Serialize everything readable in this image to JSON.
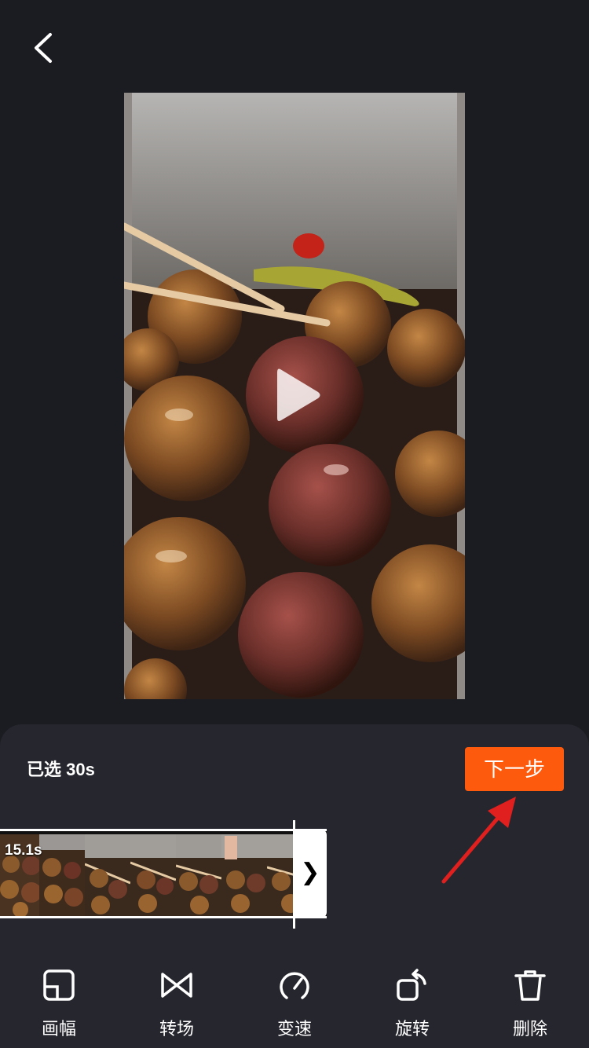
{
  "header": {
    "back_icon": "chevron-left-icon"
  },
  "preview": {
    "play_icon": "play-icon"
  },
  "selection": {
    "selected_label": "已选 30s"
  },
  "actions": {
    "next_label": "下一步"
  },
  "timeline": {
    "duration_label": "15.1s",
    "trim_handle_glyph": "❯"
  },
  "toolbar": {
    "items": [
      {
        "label": "画幅",
        "icon": "aspect-ratio-icon"
      },
      {
        "label": "转场",
        "icon": "transition-icon"
      },
      {
        "label": "变速",
        "icon": "speed-icon"
      },
      {
        "label": "旋转",
        "icon": "rotate-icon"
      },
      {
        "label": "删除",
        "icon": "trash-icon"
      }
    ]
  },
  "colors": {
    "accent": "#fe5a0e",
    "background": "#1b1b22",
    "panel": "#26262e",
    "annotation": "#e0201e"
  }
}
